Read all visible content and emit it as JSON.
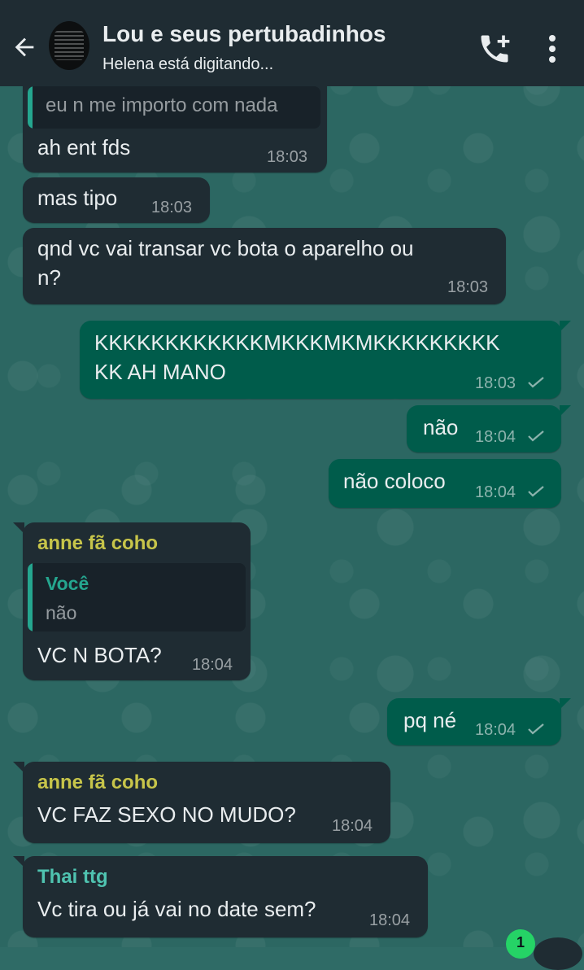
{
  "header": {
    "title": "Lou e seus pertubadinhos",
    "subtitle": "Helena está digitando...",
    "back_icon": "arrow-left-icon",
    "call_icon": "add-call-icon",
    "menu_icon": "more-vert-icon"
  },
  "colors": {
    "header_bg": "#1f2c33",
    "incoming_bubble": "#1f2c33",
    "outgoing_bubble": "#005c4b",
    "sender_anne": "#c7c54a",
    "sender_thai": "#4fc3b0",
    "quote_voce": "#25a68f"
  },
  "messages": [
    {
      "id": "m0",
      "quote_text": "eu n me importo com nada",
      "text": "ah ent fds",
      "time": "18:03"
    },
    {
      "id": "m1",
      "text": "mas tipo",
      "time": "18:03"
    },
    {
      "id": "m2",
      "text_line1": "qnd vc vai transar vc bota o aparelho ou",
      "text_line2": "n?",
      "time": "18:03"
    },
    {
      "id": "m3",
      "text_line1": "KKKKKKKKKKKKMKKKMKMKKKKKKKKK",
      "text_line2": "KK AH MANO",
      "time": "18:03"
    },
    {
      "id": "m4",
      "text": "não",
      "time": "18:04"
    },
    {
      "id": "m5",
      "text": "não coloco",
      "time": "18:04"
    },
    {
      "id": "m6",
      "sender": "anne fã coho",
      "quote_author": "Você",
      "quote_text": "não",
      "text": "VC N BOTA?",
      "time": "18:04"
    },
    {
      "id": "m7",
      "text": "pq né",
      "time": "18:04"
    },
    {
      "id": "m8",
      "sender": "anne fã coho",
      "text": "VC FAZ SEXO NO MUDO?",
      "time": "18:04"
    },
    {
      "id": "m9",
      "sender": "Thai ttg",
      "text": "Vc tira ou já vai no date sem?",
      "time": "18:04"
    }
  ],
  "unread_count": "1"
}
